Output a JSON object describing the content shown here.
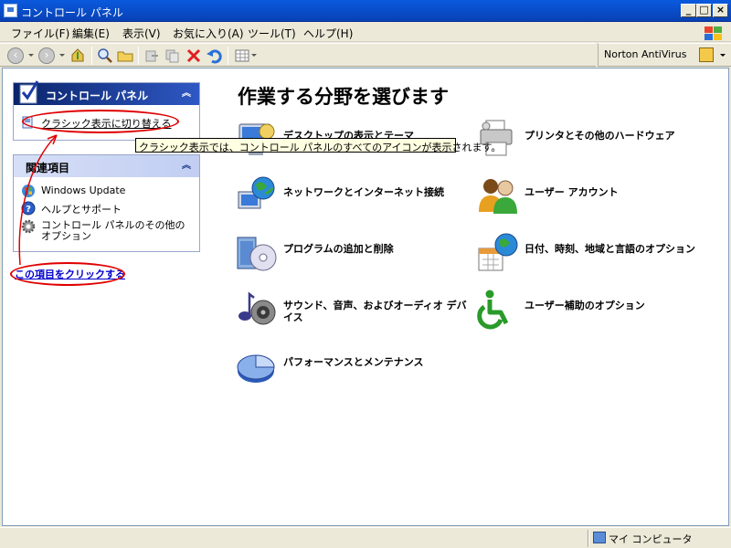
{
  "window": {
    "title": "コントロール パネル"
  },
  "menu": {
    "items": [
      "ファイル(F)",
      "編集(E)",
      "表示(V)",
      "お気に入り(A)",
      "ツール(T)",
      "ヘルプ(H)"
    ]
  },
  "toolbar": {
    "norton_label": "Norton AntiVirus"
  },
  "left_panel": {
    "title": "コントロール パネル",
    "switch_link": "クラシック表示に切り替える",
    "related_title": "関連項目",
    "related": [
      {
        "label": "Windows Update",
        "icon": "windows-update-icon"
      },
      {
        "label": "ヘルプとサポート",
        "icon": "help-icon"
      },
      {
        "label": "コントロール パネルのその他のオプション",
        "icon": "gear-icon"
      }
    ]
  },
  "tooltip": "クラシック表示では、コントロール パネルのすべてのアイコンが表示されます。",
  "main": {
    "heading": "作業する分野を選びます",
    "categories": [
      {
        "label": "デスクトップの表示とテーマ",
        "icon": "display-icon"
      },
      {
        "label": "プリンタとその他のハードウェア",
        "icon": "printer-icon"
      },
      {
        "label": "ネットワークとインターネット接続",
        "icon": "network-icon"
      },
      {
        "label": "ユーザー アカウント",
        "icon": "users-icon"
      },
      {
        "label": "プログラムの追加と削除",
        "icon": "programs-icon"
      },
      {
        "label": "日付、時刻、地域と言語のオプション",
        "icon": "datetime-icon"
      },
      {
        "label": "サウンド、音声、およびオーディオ デバイス",
        "icon": "sound-icon"
      },
      {
        "label": "ユーザー補助のオプション",
        "icon": "accessibility-icon"
      },
      {
        "label": "パフォーマンスとメンテナンス",
        "icon": "performance-icon"
      }
    ]
  },
  "annotation": {
    "text": "この項目をクリックする"
  },
  "status": {
    "location": "マイ コンピュータ"
  },
  "colors": {
    "title_blue": "#0a5ade",
    "annotation_red": "#e00000",
    "link_blue": "#0000cc"
  }
}
